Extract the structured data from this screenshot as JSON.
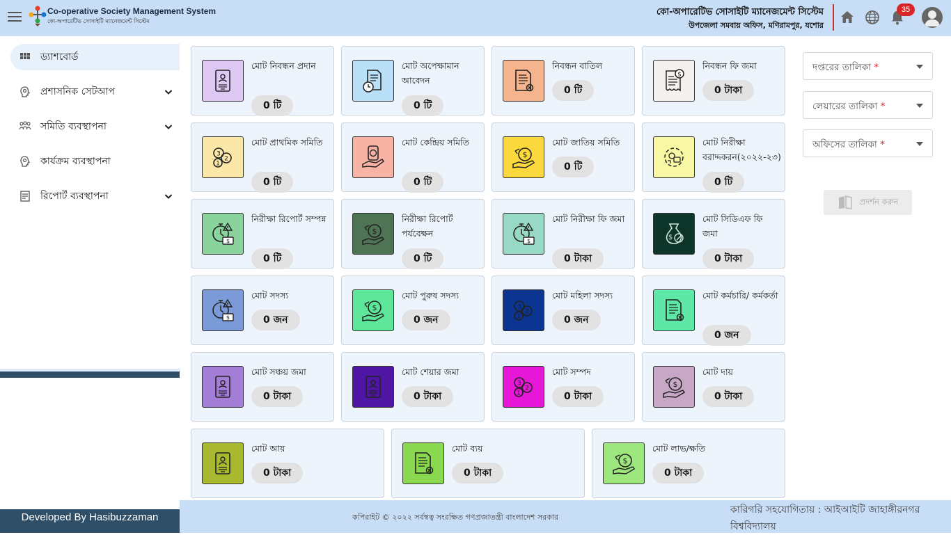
{
  "header": {
    "brand_en": "Co-operative Society Management System",
    "brand_bn": "কো-অপারেটিভ সোসাইটি ম্যানেজমেন্ট সিস্টেম",
    "title": "কো-অপারেটিভ সোসাইটি ম্যানেজমেন্ট সিস্টেম",
    "subtitle": "উপজেলা সমবায় অফিস, মণিরামপুর, যশোর",
    "notification_count": "35"
  },
  "sidebar": {
    "items": [
      {
        "label": "ড্যাশবোর্ড",
        "icon": "grid-icon",
        "active": true
      },
      {
        "label": "প্রশাসনিক সেটআপ",
        "icon": "gear-head-icon"
      },
      {
        "label": "সমিতি ব্যবস্থাপনা",
        "icon": "users-icon"
      },
      {
        "label": "কার্যক্রম ব্যবস্থাপনা",
        "icon": "gear-head-icon"
      },
      {
        "label": "রিপোর্ট ব্যবস্থাপনা",
        "icon": "report-icon"
      }
    ],
    "developer": "Developed By Hasibuzzaman"
  },
  "cards": [
    {
      "title": "মোট নিবন্ধন প্রদান",
      "value": "0 টি",
      "color": "#e0c8f4",
      "icon": "id-card-icon"
    },
    {
      "title": "মোট অপেক্ষামান আবেদন",
      "value": "0 টি",
      "color": "#b9e0f6",
      "icon": "document-clock-icon"
    },
    {
      "title": "নিবন্ধন বাতিল",
      "value": "0 টি",
      "color": "#f6b48e",
      "icon": "document-cancel-icon"
    },
    {
      "title": "নিবন্ধন ফি জমা",
      "value": "0 টাকা",
      "color": "#f3f0ed",
      "icon": "receipt-coin-icon"
    },
    {
      "title": "মোট প্রাথমিক সমিতি",
      "value": "0 টি",
      "color": "#fbe7a8",
      "icon": "chat-numbers-icon"
    },
    {
      "title": "মোট কেন্দ্রিয় সমিতি",
      "value": "0 টি",
      "color": "#f7b4a4",
      "icon": "coin-hand-icon"
    },
    {
      "title": "মোট জাতিয় সমিতি",
      "value": "0 টি",
      "color": "#fbd93c",
      "icon": "money-bag-hand-icon"
    },
    {
      "title": "মোট নিরীক্ষা বরাদ্দকরন(২০২২-২৩)",
      "value": "0 টি",
      "color": "#f8f7a3",
      "icon": "coins-cycle-icon"
    },
    {
      "title": "নিরীক্ষা রিপোর্ট সম্পন্ন",
      "value": "0 টি",
      "color": "#8ad39d",
      "icon": "stopwatch-money-icon"
    },
    {
      "title": "নিরীক্ষা রিপোর্ট পর্যবেক্ষন",
      "value": "0 টি",
      "color": "#4f7355",
      "icon": "money-bag-hand-icon"
    },
    {
      "title": "মোট নিরীক্ষা ফি জমা",
      "value": "0 টাকা",
      "color": "#97d9c5",
      "icon": "stopwatch-money-icon"
    },
    {
      "title": "মোট সিডিএফ ফি জমা",
      "value": "0 টাকা",
      "color": "#0c3428",
      "icon": "money-bag-percent-icon"
    },
    {
      "title": "মোট সদস্য",
      "value": "0 জন",
      "color": "#7a9ad8",
      "icon": "stopwatch-money-icon"
    },
    {
      "title": "মোট পুরুষ সদস্য",
      "value": "0 জন",
      "color": "#5ee79a",
      "icon": "money-bag-hand-icon"
    },
    {
      "title": "মোট মহিলা সদস্য",
      "value": "0 জন",
      "color": "#0c3591",
      "icon": "chat-numbers-icon"
    },
    {
      "title": "মোট কর্মচারি/ কর্মকর্তা",
      "value": "0 জন",
      "color": "#5ee7a6",
      "icon": "document-cancel-icon"
    },
    {
      "title": "মোট সঞ্চয় জমা",
      "value": "0 টাকা",
      "color": "#a47ed6",
      "icon": "id-card-icon"
    },
    {
      "title": "মোট শেয়ার জমা",
      "value": "0 টাকা",
      "color": "#4f16a6",
      "icon": "id-card-icon"
    },
    {
      "title": "মোট সম্পদ",
      "value": "0 টাকা",
      "color": "#e617d7",
      "icon": "chat-numbers-icon"
    },
    {
      "title": "মোট দায়",
      "value": "0 টাকা",
      "color": "#c8a7c6",
      "icon": "money-bag-hand-icon"
    },
    {
      "title": "মোট আয়",
      "value": "0 টাকা",
      "color": "#a8b930",
      "icon": "id-card-icon"
    },
    {
      "title": "মোট ব্যয়",
      "value": "0 টাকা",
      "color": "#8ad84f",
      "icon": "document-cancel-icon"
    },
    {
      "title": "মোট লাভ/ক্ষতি",
      "value": "0 টাকা",
      "color": "#9de77e",
      "icon": "money-bag-hand-icon"
    }
  ],
  "filters": [
    {
      "label": "দপ্তরের তালিকা",
      "required": "*"
    },
    {
      "label": "লেয়ারের তালিকা",
      "required": "*"
    },
    {
      "label": "অফিসের তালিকা",
      "required": "*"
    }
  ],
  "show_button": "প্রদর্শন করুন",
  "footer": {
    "copyright": "কপিরাইট © ২০২২ সর্বস্বত্ব সংরক্ষিত গণপ্রজাতন্ত্রী বাংলাদেশ সরকার",
    "tech": "কারিগরি সহযোগিতায় : আইআইটি জাহাঙ্গীরনগর বিশ্ববিদ্যালয়"
  }
}
